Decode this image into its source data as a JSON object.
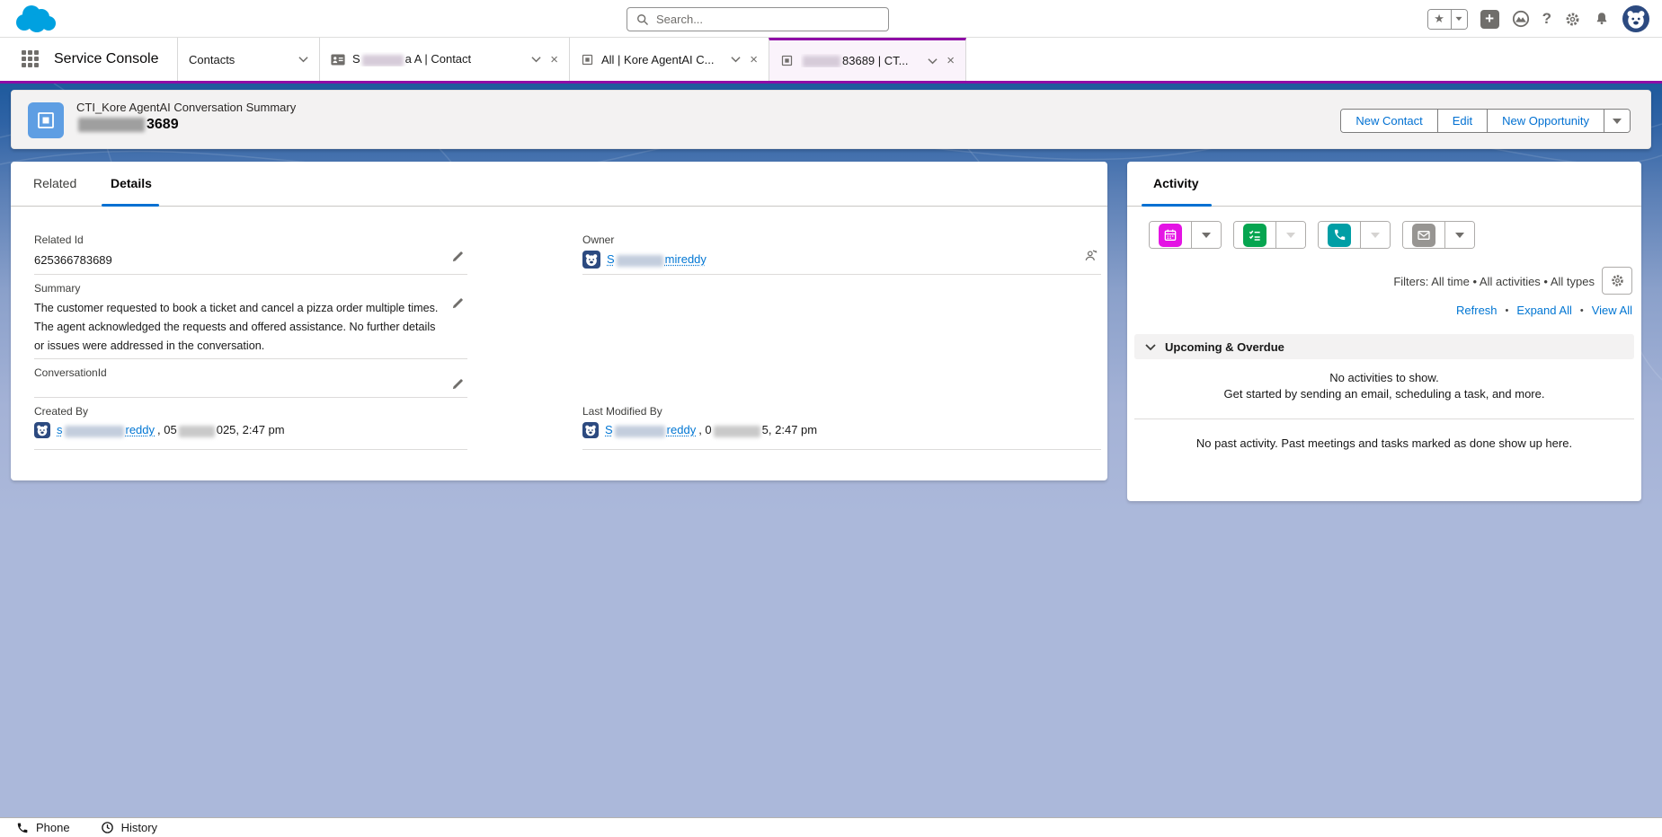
{
  "app": {
    "name": "Service Console"
  },
  "global_header": {
    "search_placeholder": "Search...",
    "icons": {
      "favorites": "star-icon",
      "global_actions": "plus-icon",
      "trailhead": "trailhead-icon",
      "help": "question-icon",
      "setup": "gear-icon",
      "notifications": "bell-icon",
      "avatar": "bear-avatar"
    }
  },
  "nav": {
    "tabs": {
      "contacts": {
        "label": "Contacts"
      },
      "contact": {
        "name_prefix": "S",
        "name_suffix": "a A | Contact"
      },
      "list": {
        "label": "All | Kore AgentAI C..."
      },
      "record": {
        "name_suffix": "83689 | CT..."
      }
    }
  },
  "record_header": {
    "object_label": "CTI_Kore AgentAI Conversation Summary",
    "record_name_visible": "3689",
    "actions": {
      "new_contact": "New Contact",
      "edit": "Edit",
      "new_opportunity": "New Opportunity"
    }
  },
  "details": {
    "tab_related": "Related",
    "tab_details": "Details",
    "related_id": {
      "label": "Related Id",
      "value": "625366783689"
    },
    "owner": {
      "label": "Owner",
      "name_prefix": "S",
      "name_suffix": "mireddy"
    },
    "summary": {
      "label": "Summary",
      "value": "The customer requested to book a ticket and cancel a pizza order multiple times. The agent acknowledged the requests and offered assistance. No further details or issues were addressed in the conversation."
    },
    "conversation_id": {
      "label": "ConversationId",
      "value": ""
    },
    "created_by": {
      "label": "Created By",
      "name_prefix": "s",
      "name_suffix": "reddy",
      "date_prefix": ", 05",
      "date_suffix": "025, 2:47 pm"
    },
    "last_modified_by": {
      "label": "Last Modified By",
      "name_prefix": "S",
      "name_suffix": "reddy",
      "date_prefix": ", 0",
      "date_suffix": "5, 2:47 pm"
    }
  },
  "activity": {
    "title": "Activity",
    "filters_text": "Filters: All time • All activities • All types",
    "separator": "•",
    "refresh": "Refresh",
    "expand_all": "Expand All",
    "view_all": "View All",
    "upcoming_title": "Upcoming & Overdue",
    "empty_line1": "No activities to show.",
    "empty_line2": "Get started by sending an email, scheduling a task, and more.",
    "past_text": "No past activity. Past meetings and tasks marked as done show up here."
  },
  "utility_bar": {
    "phone": "Phone",
    "history": "History"
  },
  "colors": {
    "brand_link": "#0176d3",
    "active_tab_accent": "#8f0ca6",
    "record_icon": "#5e9ee3",
    "event_icon": "#e414e4",
    "task_icon": "#06a550",
    "call_icon": "#009ea5",
    "email_icon": "#979592",
    "background_top": "#1e5a9d",
    "background_bottom": "#abb8da"
  }
}
